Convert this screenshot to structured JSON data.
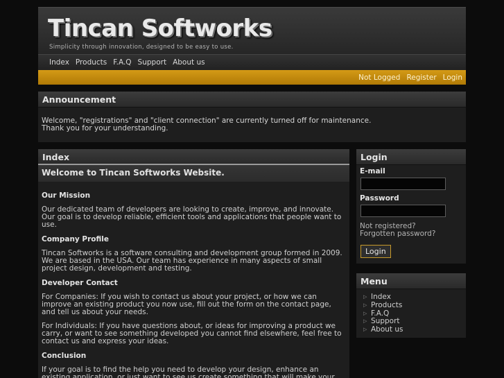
{
  "header": {
    "logo": "Tincan Softworks",
    "tagline": "Simplicity through innovation, designed to be easy to use."
  },
  "nav": [
    "Index",
    "Products",
    "F.A.Q",
    "Support",
    "About us"
  ],
  "userbar": {
    "status": "Not Logged",
    "register": "Register",
    "login": "Login"
  },
  "announcement": {
    "title": "Announcement",
    "line1": "Welcome, \"registrations\" and \"client connection\" are currently turned off for maintenance.",
    "line2": "Thank you for your understanding."
  },
  "main": {
    "title": "Index",
    "welcome": "Welcome to Tincan Softworks Website.",
    "sections": [
      {
        "heading": "Our Mission",
        "paras": [
          "Our dedicated team of developers are looking to create, improve, and innovate. Our goal is to develop reliable, efficient tools and applications that people want to use."
        ]
      },
      {
        "heading": "Company Profile",
        "paras": [
          "Tincan Softworks is a software consulting and development group formed in 2009. We are based in the USA. Our team has experience in many aspects of small project design, development and testing."
        ]
      },
      {
        "heading": "Developer Contact",
        "paras": [
          "For Companies: If you wish to contact us about your project, or how we can improve an existing product you now use, fill out the form on the contact page, and tell us about your needs.",
          "For Individuals: If you have questions about, or ideas for improving a product we carry, or want to see something developed you cannot find elsewhere, feel free to contact us and express your ideas."
        ]
      },
      {
        "heading": "Conclusion",
        "paras": [
          "If your goal is to find the help you need to develop your design, enhance an existing application, or just want to see us create something that will make your life just a little easier, please let us know."
        ]
      }
    ]
  },
  "login": {
    "title": "Login",
    "email_label": "E-mail",
    "password_label": "Password",
    "not_registered": "Not registered?",
    "forgot": "Forgotten password?",
    "button": "Login"
  },
  "menu": {
    "title": "Menu",
    "items": [
      "Index",
      "Products",
      "F.A.Q",
      "Support",
      "About us"
    ]
  }
}
